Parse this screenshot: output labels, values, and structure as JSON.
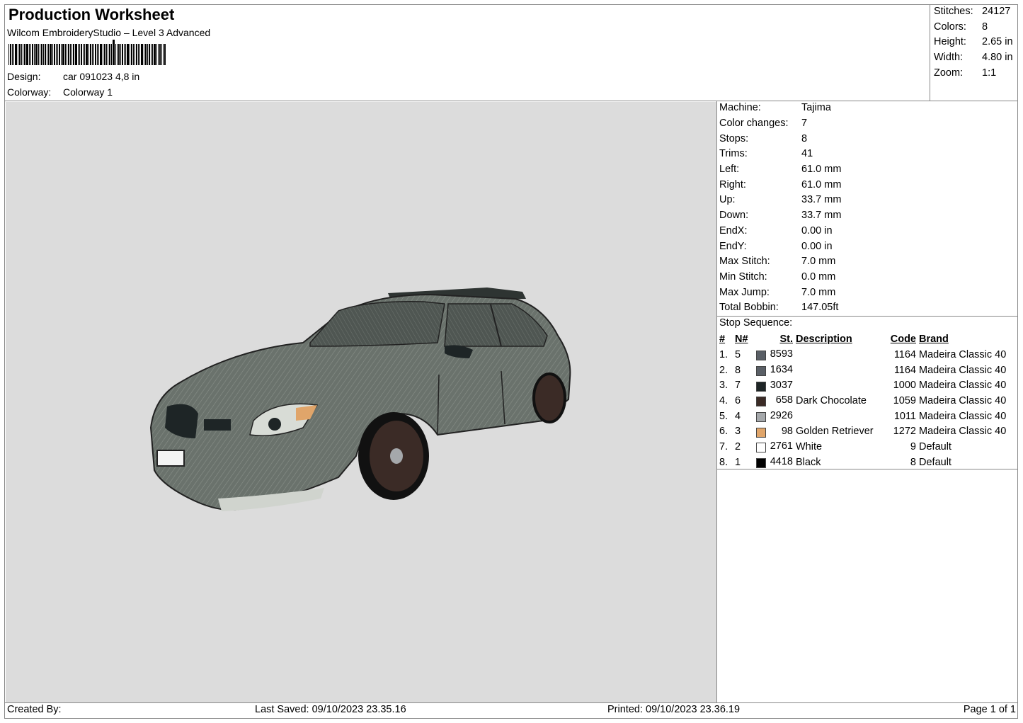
{
  "header": {
    "title": "Production Worksheet",
    "software": "Wilcom EmbroideryStudio – Level 3 Advanced",
    "design_label": "Design:",
    "design_value": "car 091023 4,8 in",
    "colorway_label": "Colorway:",
    "colorway_value": "Colorway 1"
  },
  "stats": [
    {
      "label": "Stitches:",
      "value": "24127"
    },
    {
      "label": "Colors:",
      "value": "8"
    },
    {
      "label": "Height:",
      "value": "2.65 in"
    },
    {
      "label": "Width:",
      "value": "4.80 in"
    },
    {
      "label": "Zoom:",
      "value": "1:1"
    }
  ],
  "machine_info": [
    {
      "label": "Machine:",
      "value": "Tajima"
    },
    {
      "label": "Color changes:",
      "value": "7"
    },
    {
      "label": "Stops:",
      "value": "8"
    },
    {
      "label": "Trims:",
      "value": "41"
    },
    {
      "label": "Left:",
      "value": "61.0 mm"
    },
    {
      "label": "Right:",
      "value": "61.0 mm"
    },
    {
      "label": "Up:",
      "value": "33.7 mm"
    },
    {
      "label": "Down:",
      "value": "33.7 mm"
    },
    {
      "label": "EndX:",
      "value": "0.00 in"
    },
    {
      "label": "EndY:",
      "value": "0.00 in"
    },
    {
      "label": "Max Stitch:",
      "value": "7.0 mm"
    },
    {
      "label": "Min Stitch:",
      "value": "0.0 mm"
    },
    {
      "label": "Max Jump:",
      "value": "7.0 mm"
    },
    {
      "label": "Total Bobbin:",
      "value": "147.05ft"
    }
  ],
  "stop_sequence": {
    "title": "Stop Sequence:",
    "columns": [
      "#",
      "N#",
      "St.",
      "Description",
      "Code",
      "Brand"
    ],
    "rows": [
      {
        "idx": "1.",
        "n": "5",
        "color": "#5a5f66",
        "st": "8593",
        "desc": "",
        "code": "1164",
        "brand": "Madeira Classic 40"
      },
      {
        "idx": "2.",
        "n": "8",
        "color": "#5a5f66",
        "st": "1634",
        "desc": "",
        "code": "1164",
        "brand": "Madeira Classic 40"
      },
      {
        "idx": "3.",
        "n": "7",
        "color": "#1e2526",
        "st": "3037",
        "desc": "",
        "code": "1000",
        "brand": "Madeira Classic 40"
      },
      {
        "idx": "4.",
        "n": "6",
        "color": "#3b2b26",
        "st": "658",
        "desc": "Dark Chocolate",
        "code": "1059",
        "brand": "Madeira Classic 40"
      },
      {
        "idx": "5.",
        "n": "4",
        "color": "#a5a8ab",
        "st": "2926",
        "desc": "",
        "code": "1011",
        "brand": "Madeira Classic 40"
      },
      {
        "idx": "6.",
        "n": "3",
        "color": "#e0a56a",
        "st": "98",
        "desc": "Golden Retriever",
        "code": "1272",
        "brand": "Madeira Classic 40"
      },
      {
        "idx": "7.",
        "n": "2",
        "color": "#ffffff",
        "st": "2761",
        "desc": "White",
        "code": "9",
        "brand": "Default"
      },
      {
        "idx": "8.",
        "n": "1",
        "color": "#000000",
        "st": "4418",
        "desc": "Black",
        "code": "8",
        "brand": "Default"
      }
    ]
  },
  "footer": {
    "created_by": "Created By:",
    "last_saved": "Last Saved: 09/10/2023 23.35.16",
    "printed": "Printed: 09/10/2023 23.36.19",
    "page": "Page 1 of 1"
  },
  "colors": {
    "canvas": "#dcdcdc",
    "car_body": "#6a726c"
  }
}
